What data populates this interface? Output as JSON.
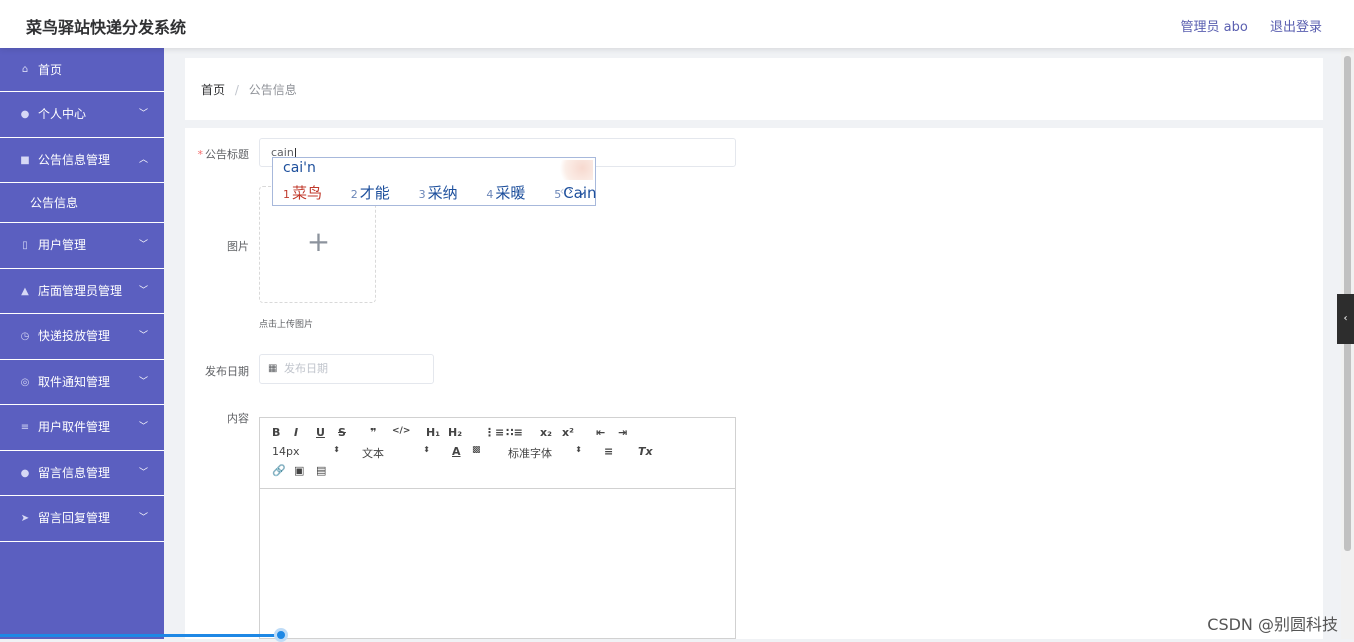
{
  "app": {
    "title": "菜鸟驿站快递分发系统",
    "admin_label": "管理员 abo",
    "logout_label": "退出登录"
  },
  "sidebar": {
    "items": [
      {
        "label": "首页",
        "icon": "home-icon"
      },
      {
        "label": "个人中心",
        "icon": "user-icon"
      },
      {
        "label": "公告信息管理",
        "icon": "clipboard-icon",
        "expanded": true,
        "sub": "公告信息"
      },
      {
        "label": "用户管理",
        "icon": "phone-icon"
      },
      {
        "label": "店面管理员管理",
        "icon": "person-icon"
      },
      {
        "label": "快递投放管理",
        "icon": "clock-icon"
      },
      {
        "label": "取件通知管理",
        "icon": "globe-icon"
      },
      {
        "label": "用户取件管理",
        "icon": "list-icon"
      },
      {
        "label": "留言信息管理",
        "icon": "pin-icon"
      },
      {
        "label": "留言回复管理",
        "icon": "send-icon"
      }
    ]
  },
  "breadcrumb": {
    "home": "首页",
    "separator": "/",
    "current": "公告信息"
  },
  "form": {
    "title_label": "公告标题",
    "title_value": "cain",
    "image_label": "图片",
    "upload_tip": "点击上传图片",
    "date_label": "发布日期",
    "date_placeholder": "发布日期",
    "content_label": "内容"
  },
  "ime": {
    "pinyin": "cai'n",
    "candidates": [
      {
        "num": "1",
        "text": "菜鸟"
      },
      {
        "num": "2",
        "text": "才能"
      },
      {
        "num": "3",
        "text": "采纳"
      },
      {
        "num": "4",
        "text": "采暖"
      },
      {
        "num": "5",
        "text": "Cain"
      }
    ]
  },
  "editor": {
    "font_size": "14px",
    "format": "文本",
    "font_family": "标准字体"
  },
  "watermark": "CSDN @别圆科技"
}
